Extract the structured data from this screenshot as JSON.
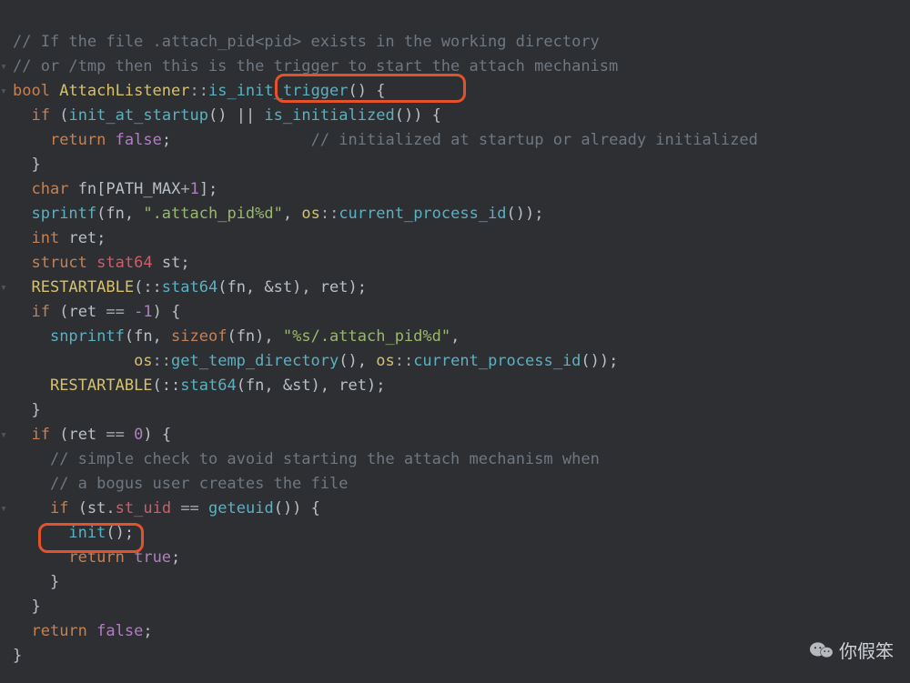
{
  "comments": {
    "c1": "// If the file .attach_pid<pid> exists in the working directory",
    "c2": "// or /tmp then this is the trigger to start the attach mechanism",
    "c3": "// initialized at startup or already initialized",
    "c4": "// simple check to avoid starting the attach mechanism when",
    "c5": "// a bogus user creates the file"
  },
  "kw": {
    "bool": "bool",
    "if": "if",
    "return": "return",
    "char": "char",
    "int": "int",
    "struct": "struct",
    "sizeof": "sizeof"
  },
  "ident": {
    "class": "AttachListener",
    "decl_fn": "is_init_trigger",
    "init_at_startup": "init_at_startup",
    "is_initialized": "is_initialized",
    "fn": "fn",
    "path_max": "PATH_MAX",
    "sprintf": "sprintf",
    "snprintf": "snprintf",
    "os": "os",
    "cpid": "current_process_id",
    "ret": "ret",
    "stat64t": "stat64",
    "st": "st",
    "restartable": "RESTARTABLE",
    "stat64fn": "stat64",
    "get_temp": "get_temp_directory",
    "st_uid": "st_uid",
    "geteuid": "geteuid",
    "init": "init"
  },
  "lit": {
    "one": "1",
    "neg1": "-1",
    "zero": "0",
    "true": "true",
    "false": "false"
  },
  "str": {
    "s1": "\".attach_pid%d\"",
    "s2": "\"%s/.attach_pid%d\""
  },
  "watermark": "你假笨"
}
